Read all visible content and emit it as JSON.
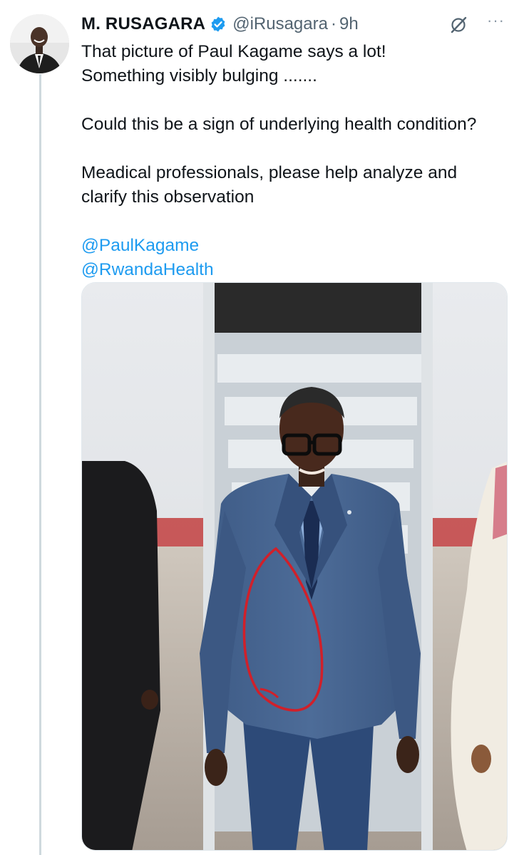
{
  "user": {
    "display_name": "M. RUSAGARA",
    "handle": "@iRusagara",
    "separator": "·",
    "time": "9h"
  },
  "tweet": {
    "line1": "That picture of Paul Kagame says a lot!",
    "line2": "Something visibly bulging .......",
    "line3": "Could this be a sign of underlying health condition?",
    "line4": "Meadical professionals, please help analyze and clarify this observation",
    "mention1": "@PaulKagame",
    "mention2": "@RwandaHealth"
  },
  "icons": {
    "verified": "verified-badge-icon",
    "grok": "grok-icon",
    "more": "more-options-icon"
  },
  "colors": {
    "link": "#1d9bf0",
    "text": "#0f1419",
    "secondary": "#536471",
    "annotation": "#d0202a"
  }
}
